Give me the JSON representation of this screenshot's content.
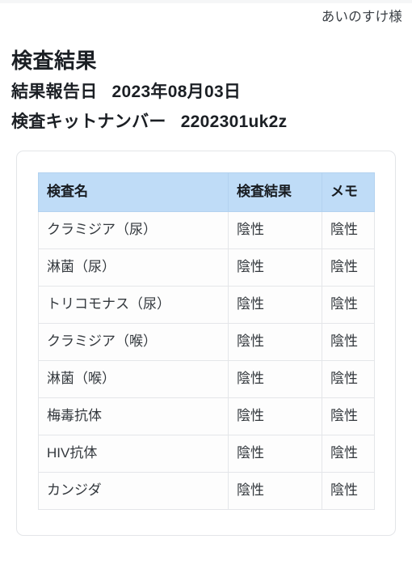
{
  "header": {
    "greeting": "あいのすけ様"
  },
  "page_title": "検査結果",
  "meta": {
    "report_date_label": "結果報告日",
    "report_date_value": "2023年08月03日",
    "kit_number_label": "検査キットナンバー",
    "kit_number_value": "2202301uk2z"
  },
  "table": {
    "columns": [
      "検査名",
      "検査結果",
      "メモ"
    ],
    "rows": [
      {
        "name": "クラミジア（尿）",
        "result": "陰性",
        "memo": "陰性"
      },
      {
        "name": "淋菌（尿）",
        "result": "陰性",
        "memo": "陰性"
      },
      {
        "name": "トリコモナス（尿）",
        "result": "陰性",
        "memo": "陰性"
      },
      {
        "name": "クラミジア（喉）",
        "result": "陰性",
        "memo": "陰性"
      },
      {
        "name": "淋菌（喉）",
        "result": "陰性",
        "memo": "陰性"
      },
      {
        "name": "梅毒抗体",
        "result": "陰性",
        "memo": "陰性"
      },
      {
        "name": "HIV抗体",
        "result": "陰性",
        "memo": "陰性"
      },
      {
        "name": "カンジダ",
        "result": "陰性",
        "memo": "陰性"
      }
    ]
  },
  "colors": {
    "table_header_bg": "#bfdcf7",
    "card_border": "#e3e5e8",
    "cell_border": "#e4e6e9",
    "text_primary": "#1b1f24",
    "text_body": "#33383d"
  }
}
